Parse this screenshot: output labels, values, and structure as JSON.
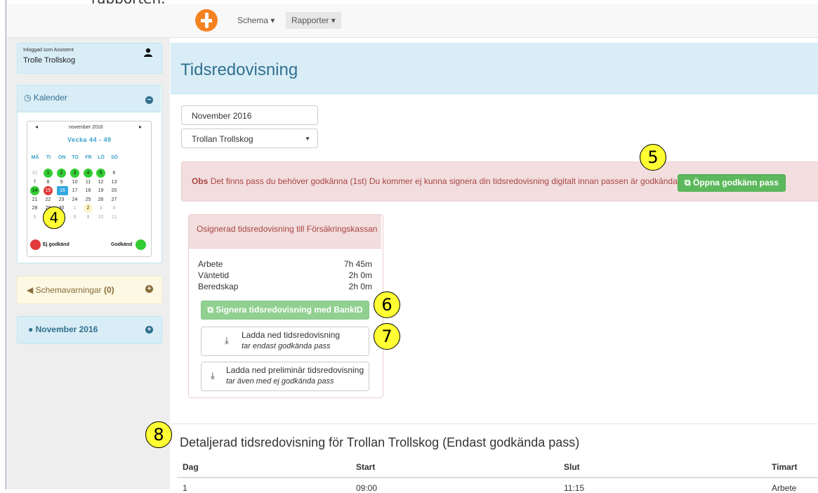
{
  "caption": "rapporten.",
  "nav": {
    "schema": "Schema ▾",
    "rapporter": "Rapporter ▾"
  },
  "user": {
    "label": "Inloggad som Assistent",
    "name": "Trolle Trollskog"
  },
  "calendar": {
    "title": "Kalender",
    "month": "november 2016",
    "week": "Vecka 44 - 49",
    "prev": "◂",
    "next": "▸",
    "weekdays": [
      "MÅ",
      "TI",
      "ON",
      "TO",
      "FR",
      "LÖ",
      "SÖ"
    ],
    "rows": [
      [
        "31",
        "1",
        "2",
        "3",
        "4",
        "5",
        "6"
      ],
      [
        "7",
        "8",
        "9",
        "10",
        "11",
        "12",
        "13"
      ],
      [
        "14",
        "15",
        "16",
        "17",
        "18",
        "19",
        "20"
      ],
      [
        "21",
        "22",
        "23",
        "24",
        "25",
        "26",
        "27"
      ],
      [
        "28",
        "29",
        "30",
        "1",
        "2",
        "3",
        "4"
      ],
      [
        "5",
        "6",
        "7",
        "8",
        "9",
        "10",
        "11"
      ]
    ],
    "legend_not_approved": "Ej godkänd",
    "legend_approved": "Godkänd"
  },
  "warnings": {
    "label": "Schemavarningar",
    "count": "(0)"
  },
  "month_panel": "November 2016",
  "page_title": "Tidsredovisning",
  "month_select": "November 2016",
  "person_select": "Trollan Trollskog",
  "alert": {
    "obs": "Obs",
    "text": "Det finns pass du behöver godkänna (1st) Du kommer ej kunna signera din tidsredovisning digitalt innan passen är godkända",
    "button": "Öppna godkänn pass"
  },
  "signing": {
    "title": "Osignerad tidsredovisning till Försäkringskassan",
    "rows": [
      {
        "label": "Arbete",
        "value": "7h 45m"
      },
      {
        "label": "Väntetid",
        "value": "2h 0m"
      },
      {
        "label": "Beredskap",
        "value": "2h 0m"
      }
    ],
    "bankid_button": "Signera tidsredovisning med BankID",
    "download1": {
      "line1": "Ladda ned tidsredovisning",
      "line2": "tar endast godkända pass"
    },
    "download2": {
      "line1": "Ladda ned preliminär tidsredovisning",
      "line2": "tar även med ej godkända pass"
    }
  },
  "detail": {
    "title": "Detaljerad tidsredovisning för Trollan Trollskog (Endast godkända pass)",
    "headers": [
      "Dag",
      "Start",
      "Slut",
      "Timart"
    ],
    "first_row": [
      "1",
      "09:00",
      "11:15",
      "Arbete"
    ]
  },
  "callouts": [
    "4",
    "5",
    "6",
    "7",
    "8"
  ],
  "colors": {
    "brand_orange": "#f58220",
    "info": "#31708f",
    "danger": "#a94442",
    "success": "#5cb85c",
    "callout": "#ffff33"
  }
}
